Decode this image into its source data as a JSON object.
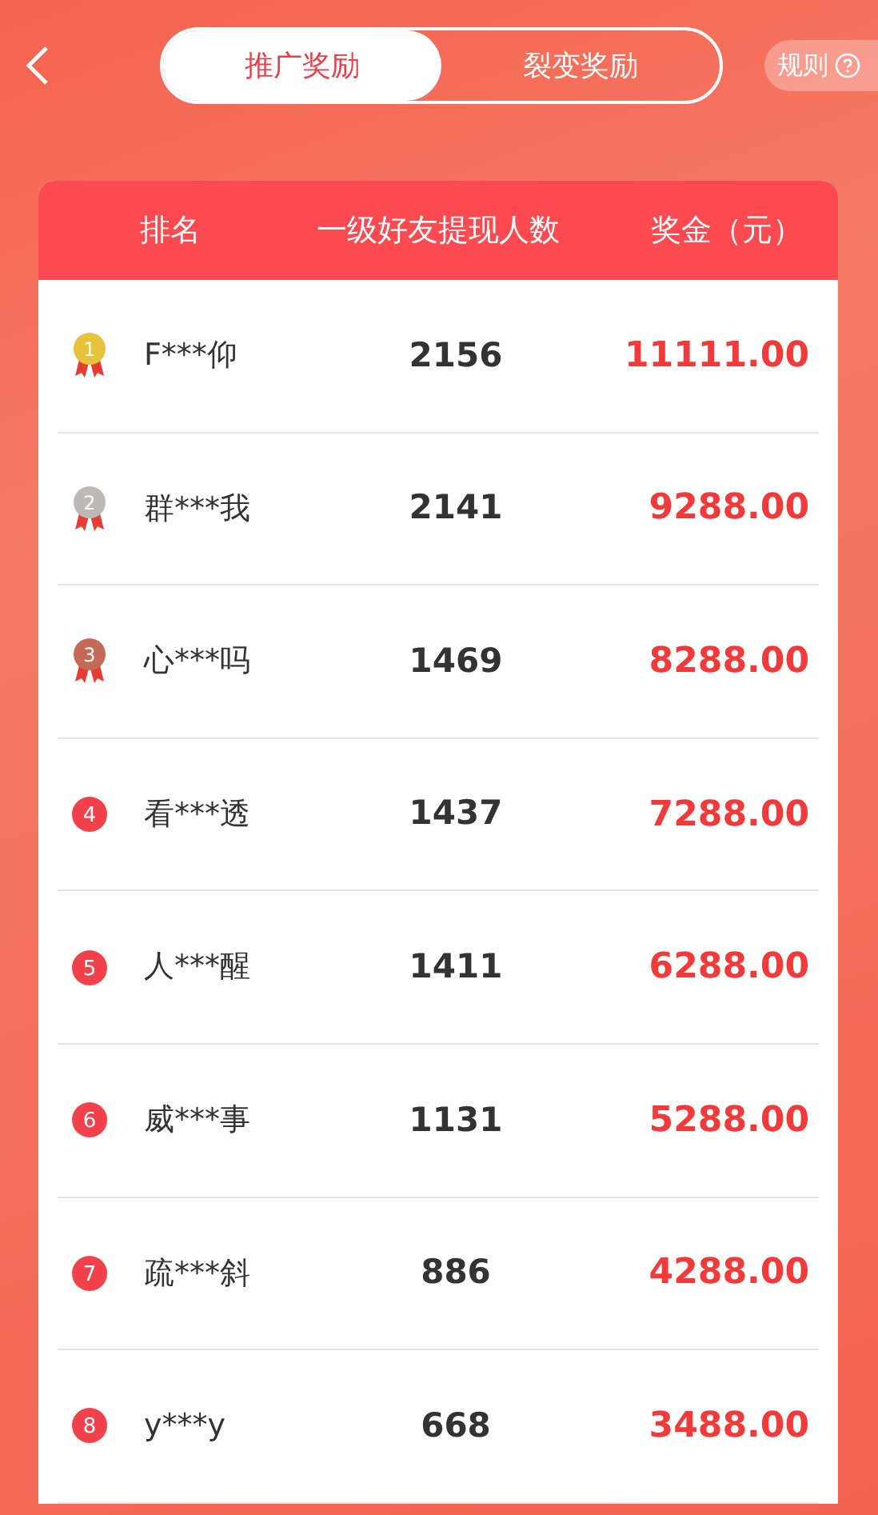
{
  "tabs": [
    {
      "label": "推广奖励",
      "selected": true
    },
    {
      "label": "裂变奖励",
      "selected": false
    }
  ],
  "rules_button": {
    "label": "规则"
  },
  "table": {
    "columns": [
      "排名",
      "一级好友提现人数",
      "奖金（元）"
    ],
    "rows": [
      {
        "rank": {
          "kind": "medal",
          "label": "1",
          "color": "#e8c23a"
        },
        "name": "F***仰",
        "count": "2156",
        "bonus": "11111.00"
      },
      {
        "rank": {
          "kind": "medal",
          "label": "2",
          "color": "#bdbab5"
        },
        "name": "群***我",
        "count": "2141",
        "bonus": "9288.00"
      },
      {
        "rank": {
          "kind": "medal",
          "label": "3",
          "color": "#c56a57"
        },
        "name": "心***吗",
        "count": "1469",
        "bonus": "8288.00"
      },
      {
        "rank": {
          "kind": "circle",
          "label": "4"
        },
        "name": "看***透",
        "count": "1437",
        "bonus": "7288.00"
      },
      {
        "rank": {
          "kind": "circle",
          "label": "5"
        },
        "name": "人***醒",
        "count": "1411",
        "bonus": "6288.00"
      },
      {
        "rank": {
          "kind": "circle",
          "label": "6"
        },
        "name": "威***事",
        "count": "1131",
        "bonus": "5288.00"
      },
      {
        "rank": {
          "kind": "circle",
          "label": "7"
        },
        "name": "疏***斜",
        "count": "886",
        "bonus": "4288.00"
      },
      {
        "rank": {
          "kind": "circle",
          "label": "8"
        },
        "name": "y***y",
        "count": "668",
        "bonus": "3488.00"
      }
    ]
  }
}
